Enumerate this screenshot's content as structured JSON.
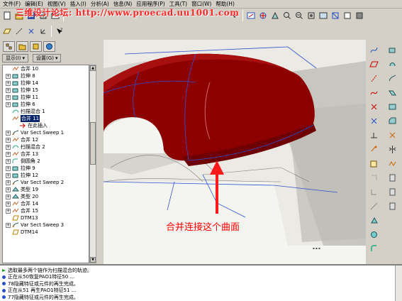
{
  "menu": {
    "items": [
      "文件(F)",
      "编辑(E)",
      "视图(V)",
      "插入(I)",
      "分析(A)",
      "信息(N)",
      "应用程序(P)",
      "工具(T)",
      "窗口(W)",
      "帮助(H)"
    ],
    "watermark": "三维设计论坛: http://www.proecad.uu1001.com"
  },
  "left_panel": {
    "display_label": "显示(I)",
    "settings_label": "设置(G)",
    "tree": [
      {
        "label": "合并 10",
        "expand": false,
        "icon": "merge"
      },
      {
        "label": "拉伸 8",
        "expand": true,
        "icon": "extrude"
      },
      {
        "label": "拉伸 14",
        "expand": true,
        "icon": "extrude"
      },
      {
        "label": "拉伸 15",
        "expand": true,
        "icon": "extrude"
      },
      {
        "label": "拉伸 11",
        "expand": true,
        "icon": "extrude"
      },
      {
        "label": "拉伸 6",
        "expand": true,
        "icon": "extrude"
      },
      {
        "label": "扫描混合 1",
        "expand": false,
        "icon": "sweepblend"
      },
      {
        "label": "合并 11",
        "expand": false,
        "icon": "merge",
        "selected": true
      },
      {
        "label": "在此插入",
        "expand": false,
        "icon": "insert"
      },
      {
        "label": "Var Sect Sweep 1",
        "expand": true,
        "icon": "varsweep"
      },
      {
        "label": "合并 12",
        "expand": true,
        "icon": "merge"
      },
      {
        "label": "扫描混合 2",
        "expand": true,
        "icon": "sweepblend"
      },
      {
        "label": "合并 13",
        "expand": true,
        "icon": "merge"
      },
      {
        "label": "倒圆角 2",
        "expand": true,
        "icon": "round"
      },
      {
        "label": "拉伸 9",
        "expand": true,
        "icon": "extrude"
      },
      {
        "label": "拉伸 12",
        "expand": true,
        "icon": "extrude"
      },
      {
        "label": "Var Sect Sweep 2",
        "expand": true,
        "icon": "varsweep"
      },
      {
        "label": "类型 19",
        "expand": true,
        "icon": "type"
      },
      {
        "label": "类型 20",
        "expand": true,
        "icon": "type"
      },
      {
        "label": "合并 14",
        "expand": true,
        "icon": "merge"
      },
      {
        "label": "合并 15",
        "expand": true,
        "icon": "merge"
      },
      {
        "label": "DTM13",
        "expand": false,
        "icon": "datum"
      },
      {
        "label": "Var Sect Sweep 3",
        "expand": true,
        "icon": "varsweep"
      },
      {
        "label": "DTM14",
        "expand": false,
        "icon": "datum"
      }
    ]
  },
  "viewport": {
    "annotation": "合并连接这个曲面",
    "arrow_color": "#ff1a1a",
    "surface_color": "#8c0000"
  },
  "messages": [
    {
      "text": "选取最多两个链作为扫描混合的轨迹。",
      "kind": "prompt"
    },
    {
      "text": "正在从50恢复PAO1特征50 ...",
      "kind": "info"
    },
    {
      "text": "78隐藏特征或元件的再生完成。",
      "kind": "info"
    },
    {
      "text": "正在从51 再生PAO1特征51 ...",
      "kind": "info"
    },
    {
      "text": "77隐藏特征或元件的再生完成。",
      "kind": "info"
    }
  ]
}
